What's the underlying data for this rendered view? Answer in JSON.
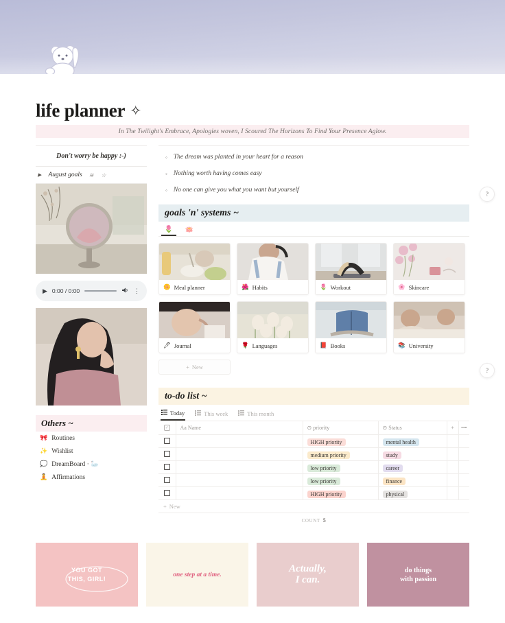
{
  "cover": {
    "icon": "waving-bear-icon",
    "bg_color": "#c5c7de"
  },
  "header": {
    "title": "life planner",
    "sparkle": "✧",
    "quote": "In The Twilight's Embrace, Apologies woven, I Scoured The Horizons To Find Your Presence Aglow."
  },
  "sidebar": {
    "mini_quote": "Don't worry be happy :-)",
    "toggle": {
      "arrow": "▶",
      "label": "August goals",
      "wave": "≋",
      "star": "☆"
    },
    "images": [
      {
        "name": "mirror-flowers-photo"
      },
      {
        "name": "girl-pink-sweater-photo"
      }
    ],
    "audio": {
      "play_icon": "▶",
      "time": "0:00 / 0:00",
      "volume_icon": "🔊",
      "menu_icon": "⋮"
    },
    "others": {
      "heading": "Others ~",
      "items": [
        {
          "emoji": "🎀",
          "label": "Routines"
        },
        {
          "emoji": "✨",
          "label": "Wishlist"
        },
        {
          "emoji": "💭",
          "label": "DreamBoard  · 🦢"
        },
        {
          "emoji": "🧘",
          "label": "Affirmations"
        }
      ]
    }
  },
  "bullets": [
    "The dream was planted in your heart for a reason",
    "Nothing worth having comes easy",
    "No one can give you what you want but yourself"
  ],
  "goals": {
    "heading": "goals 'n' systems ~",
    "icon_tabs": [
      {
        "emoji": "🌷",
        "active": true
      },
      {
        "emoji": "🪷",
        "active": false
      }
    ],
    "cards": [
      {
        "emoji": "🌼",
        "label": "Meal planner",
        "thumb": "#e2dcd0"
      },
      {
        "emoji": "🌺",
        "label": "Habits",
        "thumb": "#d9d6d3"
      },
      {
        "emoji": "🌷",
        "label": "Workout",
        "thumb": "#dadbd9"
      },
      {
        "emoji": "🌸",
        "label": "Skincare",
        "thumb": "#e7dadb"
      },
      {
        "emoji": "🖊",
        "label": "Journal",
        "thumb": "#cfc4bb"
      },
      {
        "emoji": "🌹",
        "label": "Languages",
        "thumb": "#dfddd0"
      },
      {
        "emoji": "📕",
        "label": "Books",
        "thumb": "#cfd6da"
      },
      {
        "emoji": "📚",
        "label": "University",
        "thumb": "#d7cdc3"
      }
    ],
    "new_button": {
      "icon": "+",
      "label": "New"
    }
  },
  "todo": {
    "heading": "to-do list ~",
    "tabs": [
      {
        "icon": "☰",
        "label": "Today",
        "active": true
      },
      {
        "icon": "☰",
        "label": "This week",
        "active": false
      },
      {
        "icon": "☰",
        "label": "This month",
        "active": false
      }
    ],
    "columns": [
      {
        "icon": "Aa",
        "label": "Name"
      },
      {
        "icon": "⊙",
        "label": "priority"
      },
      {
        "icon": "⊙",
        "label": "Status"
      }
    ],
    "add_column_icon": "+",
    "more_icon": "•••",
    "rows": [
      {
        "name": "",
        "priority": "HIGH priority",
        "priority_color": "#fbddd8",
        "status": "mental health",
        "status_color": "#d5e6ef"
      },
      {
        "name": "",
        "priority": "medium priority",
        "priority_color": "#fbeacb",
        "status": "study",
        "status_color": "#f6dbe3"
      },
      {
        "name": "",
        "priority": "low priority",
        "priority_color": "#d9ead9",
        "status": "career",
        "status_color": "#e2dcef"
      },
      {
        "name": "",
        "priority": "low priority",
        "priority_color": "#d9ead9",
        "status": "finance",
        "status_color": "#fbe4c4"
      },
      {
        "name": "",
        "priority": "HIGH priority",
        "priority_color": "#fbd3cd",
        "status": "physical",
        "status_color": "#e4e2e0"
      }
    ],
    "new_row": {
      "icon": "+",
      "label": "New"
    },
    "count_label": "COUNT",
    "count_value": "5"
  },
  "banners": [
    {
      "text": "YOU GOT\nTHIS, GIRL!",
      "bg": "#f4c3c3"
    },
    {
      "text": "one step at a time.",
      "bg": "#faf5e8"
    },
    {
      "text": "Actually,\nI can.",
      "bg": "#e9cdcd"
    },
    {
      "text": "do things\nwith passion",
      "bg": "#c091a0"
    }
  ],
  "help_buttons": [
    {
      "label": "?"
    },
    {
      "label": "?"
    }
  ]
}
